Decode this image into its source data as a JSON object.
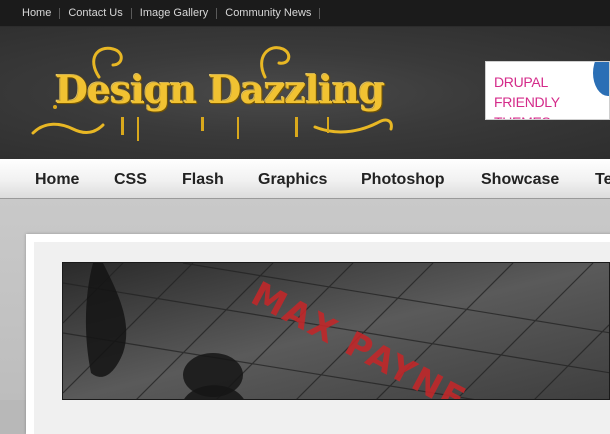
{
  "top_nav": {
    "items": [
      "Home",
      "Contact Us",
      "Image Gallery",
      "Community News"
    ]
  },
  "header": {
    "logo_text": "Design Dazzling",
    "ad_banner": {
      "line1": "DRUPAL",
      "line2": "FRIENDLY THEMES"
    }
  },
  "main_nav": {
    "items": [
      "Home",
      "CSS",
      "Flash",
      "Graphics",
      "Photoshop",
      "Showcase",
      "Te"
    ]
  },
  "featured": {
    "image_text": "MAX PAYNE"
  },
  "colors": {
    "logo_gold": "#f1c232",
    "ad_pink": "#d42b8a",
    "featured_red": "#c0282a"
  }
}
